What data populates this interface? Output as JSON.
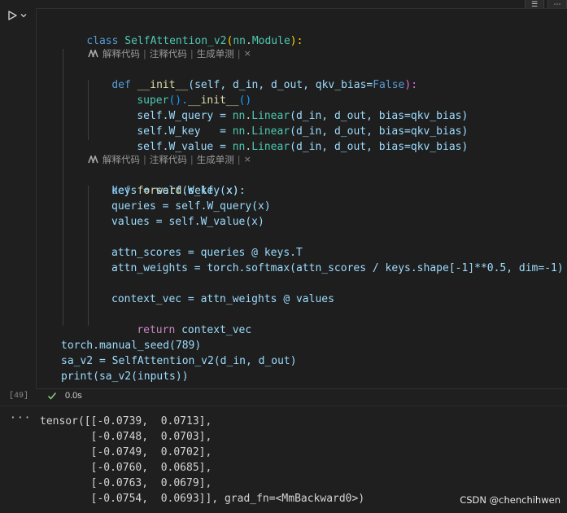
{
  "toolbar": {
    "btn1": "☰",
    "btn2": "⋯"
  },
  "cell": {
    "execution_count": "[49]",
    "status_time": "0.0s"
  },
  "code": {
    "l1": [
      "class",
      " ",
      "SelfAttention_v2",
      "(",
      "nn",
      ".",
      "Module",
      "):"
    ],
    "codelens": {
      "a": "解释代码",
      "b": "注释代码",
      "c": "生成单测",
      "sep": "|",
      "close": "×"
    },
    "init_def": [
      "def",
      " ",
      "__init__",
      "(self, d_in, d_out, qkv_bias=",
      "False",
      "):"
    ],
    "super": [
      "super",
      "().",
      "__init__",
      "()"
    ],
    "wq": [
      "self",
      ".W_query = ",
      "nn",
      ".",
      "Linear",
      "(d_in, d_out, bias=qkv_bias)"
    ],
    "wk": [
      "self",
      ".W_key   = ",
      "nn",
      ".",
      "Linear",
      "(d_in, d_out, bias=qkv_bias)"
    ],
    "wv": [
      "self",
      ".W_value = ",
      "nn",
      ".",
      "Linear",
      "(d_in, d_out, bias=qkv_bias)"
    ],
    "fwd_def": [
      "def",
      " ",
      "forward",
      "(self, x):"
    ],
    "keys": "keys = self.W_key(x)",
    "queries": "queries = self.W_query(x)",
    "values": "values = self.W_value(x)",
    "attn_scores": "attn_scores = queries @ keys.T",
    "attn_weights": "attn_weights = torch.softmax(attn_scores / keys.shape[-1]**0.5, dim=-1)",
    "context": "context_vec = attn_weights @ values",
    "ret": [
      "return",
      " context_vec"
    ],
    "seed": "torch.manual_seed(789)",
    "sa": "sa_v2 = SelfAttention_v2(d_in, d_out)",
    "print": "print(sa_v2(inputs))"
  },
  "output": {
    "more": "···",
    "lines": [
      "tensor([[-0.0739,  0.0713],",
      "        [-0.0748,  0.0703],",
      "        [-0.0749,  0.0702],",
      "        [-0.0760,  0.0685],",
      "        [-0.0763,  0.0679],",
      "        [-0.0754,  0.0693]], grad_fn=<MmBackward0>)"
    ]
  },
  "watermark": "CSDN @chenchihwen",
  "colors": {
    "keyword": "#569cd6",
    "control": "#c586c0",
    "class": "#4ec9b0",
    "function": "#dcdcaa",
    "variable": "#9cdcfe",
    "number": "#b5cea8",
    "success": "#89d185"
  }
}
